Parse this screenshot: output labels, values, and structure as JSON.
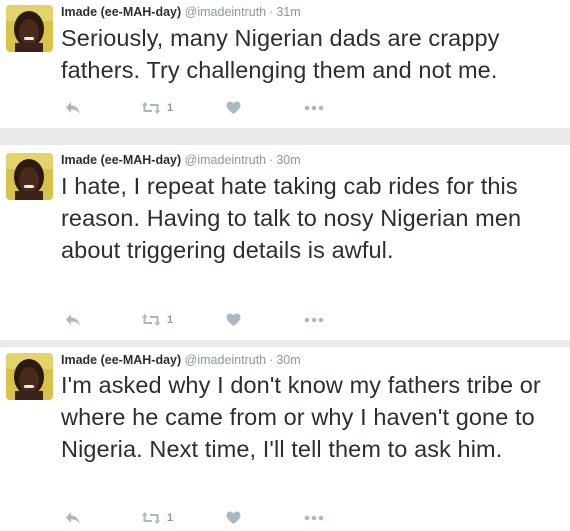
{
  "tweets": [
    {
      "name": "Imade (ee-MAH-day)",
      "handle": "@imadeintruth",
      "separator": "·",
      "time": "31m",
      "text": "Seriously, many Nigerian dads are crappy fathers. Try challenging them and not me.",
      "retweet_count": "1"
    },
    {
      "name": "Imade (ee-MAH-day)",
      "handle": "@imadeintruth",
      "separator": "·",
      "time": "30m",
      "text": "I hate, I repeat hate taking cab rides for this reason. Having to talk to nosy Nigerian men about triggering details is awful.",
      "retweet_count": "1"
    },
    {
      "name": "Imade (ee-MAH-day)",
      "handle": "@imadeintruth",
      "separator": "·",
      "time": "30m",
      "text": "I'm asked why I don't know my fathers tribe or where he came from or why I haven't gone to Nigeria. Next time, I'll tell them to ask him.",
      "retweet_count": "1"
    }
  ],
  "icons": {
    "reply": "reply-icon",
    "retweet": "retweet-icon",
    "like": "heart-icon",
    "more": "more-icon"
  },
  "colors": {
    "name": "#292f33",
    "meta": "#8899a6",
    "icon": "#aab8c2",
    "separator_bg": "#e8eaec"
  }
}
